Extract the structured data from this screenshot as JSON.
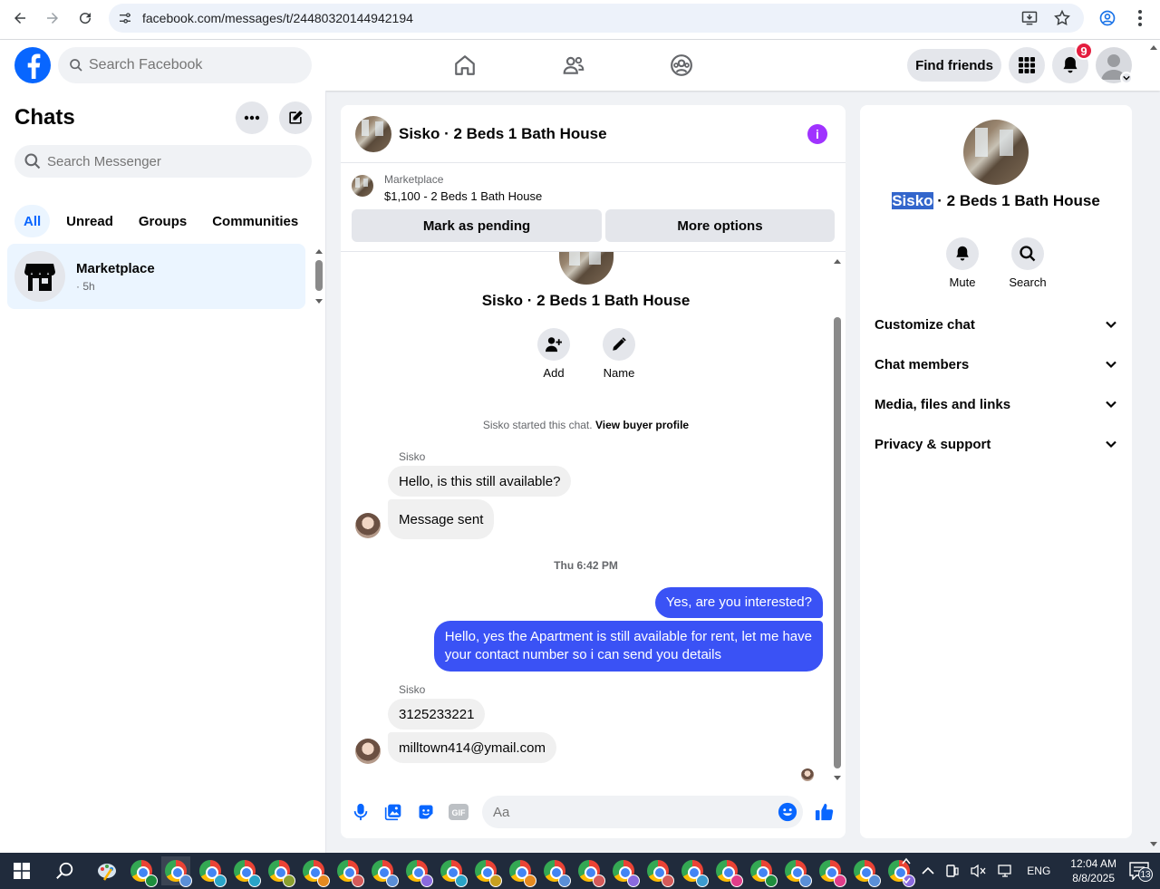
{
  "browser": {
    "url": "facebook.com/messages/t/24480320144942194"
  },
  "fb": {
    "search_placeholder": "Search Facebook",
    "find_friends": "Find friends",
    "notifications_count": "9"
  },
  "chat_list": {
    "title": "Chats",
    "search_placeholder": "Search Messenger",
    "filters": [
      "All",
      "Unread",
      "Groups",
      "Communities"
    ],
    "active_filter": "All",
    "items": [
      {
        "name": "Marketplace",
        "sub": "· 5h"
      }
    ]
  },
  "conversation": {
    "title": "Sisko · 2 Beds 1 Bath House",
    "marketplace_label": "Marketplace",
    "listing": "$1,100 - 2 Beds 1 Bath House",
    "mark_pending": "Mark as pending",
    "more_options": "More options",
    "center_name": "Sisko · 2 Beds 1 Bath House",
    "add_label": "Add",
    "name_label": "Name",
    "system_text": "Sisko started this chat.",
    "view_buyer": "View buyer profile",
    "messages": {
      "sender1": "Sisko",
      "m1": "Hello, is this still available?",
      "m2": "Message sent",
      "time1": "Thu 6:42 PM",
      "m3": "Yes, are you interested?",
      "m4_line1": "Hello, yes the Apartment is still available for rent, let me have",
      "m4_line2": "your contact number so i can send you details",
      "sender2": "Sisko",
      "m5": "3125233221",
      "m6": "milltown414@ymail.com"
    },
    "composer_placeholder": "Aa"
  },
  "details": {
    "name_highlight": "Sisko",
    "name_rest": " · 2 Beds 1 Bath House",
    "mute": "Mute",
    "search": "Search",
    "sections": [
      "Customize chat",
      "Chat members",
      "Media, files and links",
      "Privacy & support"
    ]
  },
  "taskbar": {
    "time": "12:04 AM",
    "date": "8/8/2025",
    "lang": "ENG",
    "notif_count": "13"
  },
  "colors": {
    "fb_blue": "#0866ff",
    "outgoing_bubble": "#3a52f5",
    "info_purple": "#a033ff",
    "badge_red": "#e41e3f"
  }
}
